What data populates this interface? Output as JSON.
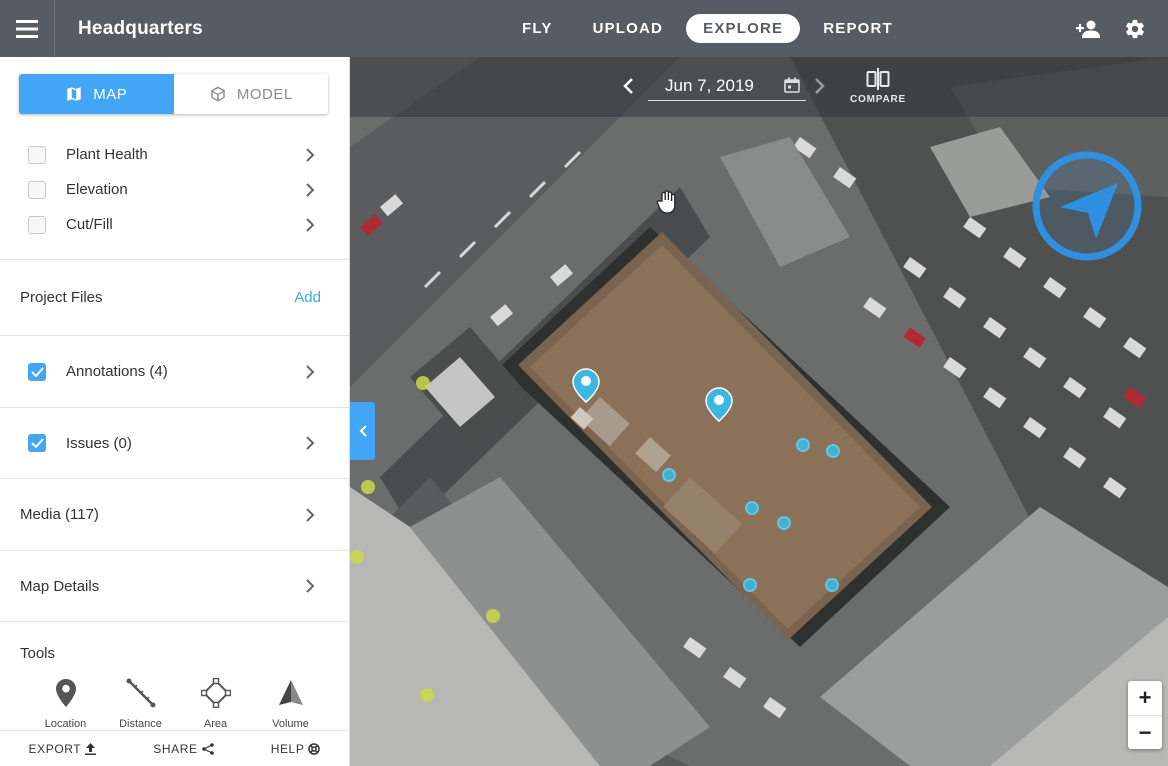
{
  "header": {
    "title": "Headquarters",
    "nav": [
      "FLY",
      "UPLOAD",
      "EXPLORE",
      "REPORT"
    ],
    "active_nav": "EXPLORE"
  },
  "sidebar": {
    "view_toggle": {
      "map_label": "MAP",
      "model_label": "MODEL",
      "selected": "MAP"
    },
    "layers": [
      {
        "label": "Plant Health",
        "checked": false
      },
      {
        "label": "Elevation",
        "checked": false
      },
      {
        "label": "Cut/Fill",
        "checked": false
      }
    ],
    "project_files": {
      "label": "Project Files",
      "action": "Add"
    },
    "annotations": {
      "label": "Annotations (4)",
      "checked": true
    },
    "issues": {
      "label": "Issues (0)",
      "checked": true
    },
    "media": {
      "label": "Media (117)"
    },
    "map_details": {
      "label": "Map Details"
    },
    "tools": {
      "title": "Tools",
      "items": [
        "Location",
        "Distance",
        "Area",
        "Volume"
      ]
    },
    "footer": {
      "export": "EXPORT",
      "share": "SHARE",
      "help": "HELP"
    }
  },
  "map": {
    "date": "Jun 7, 2019",
    "compare_label": "COMPARE",
    "zoom_in": "+",
    "zoom_out": "−"
  },
  "colors": {
    "accent": "#42a5f5",
    "topbar": "#555c63",
    "marker": "#3bb7e0",
    "issue_dot": "#c9d94a"
  }
}
